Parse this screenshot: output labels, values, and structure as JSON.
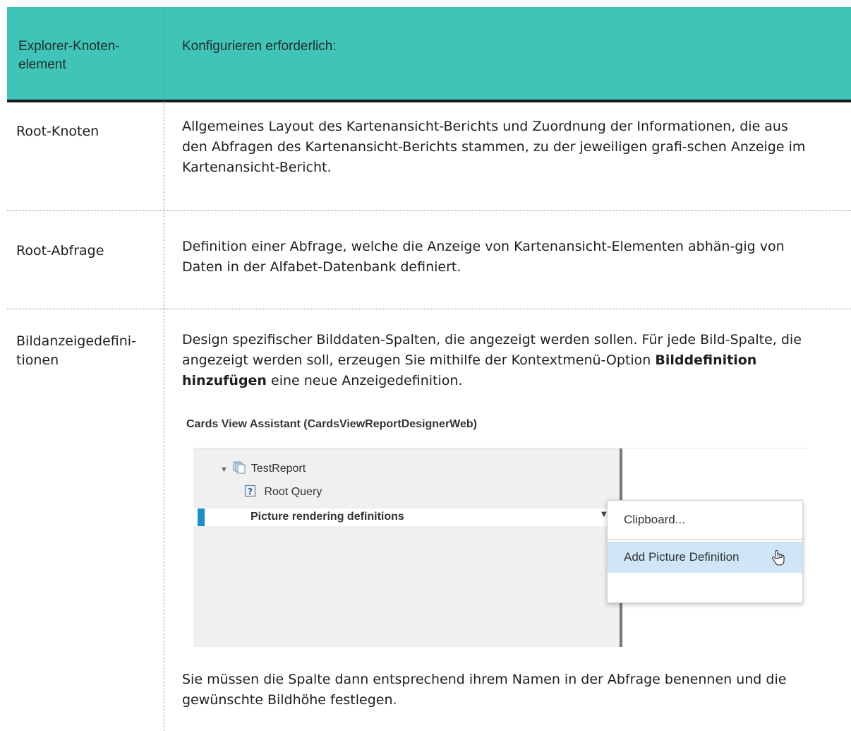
{
  "table": {
    "header": {
      "col1": "Explorer-Knoten-\nelement",
      "col2": "Konfigurieren erforderlich:"
    },
    "rows": [
      {
        "node": "Root-Knoten",
        "description": "Allgemeines Layout des Kartenansicht-Berichts und Zuordnung der Informationen, die aus den Abfragen des Kartenansicht-Berichts stammen, zu der jeweiligen grafi-schen Anzeige im Kartenansicht-Bericht."
      },
      {
        "node": "Root-Abfrage",
        "description": "Definition einer Abfrage, welche die Anzeige von Kartenansicht-Elementen abhän-gig von Daten in der Alfabet-Datenbank definiert."
      },
      {
        "node": "Bildanzeigedefini-\ntionen",
        "desc_part1": "Design spezifischer Bilddaten-Spalten, die angezeigt werden sollen. Für jede Bild-Spalte, die angezeigt werden soll, erzeugen Sie mithilfe der Kontextmenü-Option",
        "desc_bold": "Bilddefinition hinzufügen",
        "desc_part2": " eine neue Anzeigedefinition.",
        "after_text": "Sie müssen die Spalte dann entsprechend ihrem Namen in der Abfrage benennen und die gewünschte Bildhöhe festlegen."
      }
    ]
  },
  "screenshot": {
    "title": "Cards View Assistant (CardsViewReportDesignerWeb)",
    "tree": {
      "report": "TestReport",
      "root_query": "Root Query",
      "picture_defs": "Picture rendering definitions"
    },
    "menu": {
      "items": [
        "Clipboard...",
        "Add Picture Definition"
      ]
    },
    "colors": {
      "accent": "#1a8ecc",
      "highlight": "#cfe6f7",
      "header": "#40c4b8"
    }
  }
}
